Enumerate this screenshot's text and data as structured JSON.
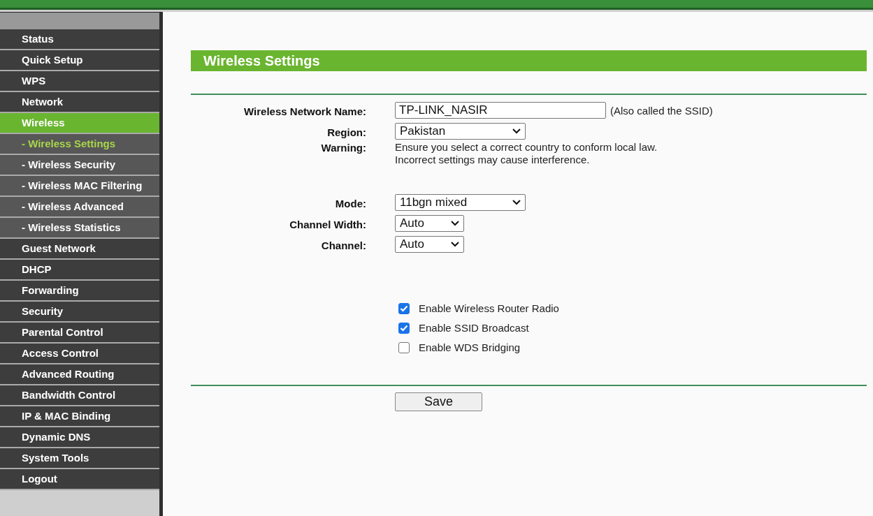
{
  "sidebar": {
    "items": [
      {
        "label": "Status",
        "kind": "main",
        "selected": false
      },
      {
        "label": "Quick Setup",
        "kind": "main",
        "selected": false
      },
      {
        "label": "WPS",
        "kind": "main",
        "selected": false
      },
      {
        "label": "Network",
        "kind": "main",
        "selected": false
      },
      {
        "label": "Wireless",
        "kind": "main",
        "selected": true
      },
      {
        "label": "- Wireless Settings",
        "kind": "sub",
        "selected": true
      },
      {
        "label": "- Wireless Security",
        "kind": "sub",
        "selected": false
      },
      {
        "label": "- Wireless MAC Filtering",
        "kind": "sub",
        "selected": false
      },
      {
        "label": "- Wireless Advanced",
        "kind": "sub",
        "selected": false
      },
      {
        "label": "- Wireless Statistics",
        "kind": "sub",
        "selected": false
      },
      {
        "label": "Guest Network",
        "kind": "main",
        "selected": false
      },
      {
        "label": "DHCP",
        "kind": "main",
        "selected": false
      },
      {
        "label": "Forwarding",
        "kind": "main",
        "selected": false
      },
      {
        "label": "Security",
        "kind": "main",
        "selected": false
      },
      {
        "label": "Parental Control",
        "kind": "main",
        "selected": false
      },
      {
        "label": "Access Control",
        "kind": "main",
        "selected": false
      },
      {
        "label": "Advanced Routing",
        "kind": "main",
        "selected": false
      },
      {
        "label": "Bandwidth Control",
        "kind": "main",
        "selected": false
      },
      {
        "label": "IP & MAC Binding",
        "kind": "main",
        "selected": false
      },
      {
        "label": "Dynamic DNS",
        "kind": "main",
        "selected": false
      },
      {
        "label": "System Tools",
        "kind": "main",
        "selected": false
      },
      {
        "label": "Logout",
        "kind": "main",
        "selected": false
      }
    ]
  },
  "page": {
    "title": "Wireless Settings",
    "fields": [
      {
        "kind": "text",
        "label": "Wireless Network Name:",
        "value": "TP-LINK_NASIR",
        "note": "(Also called the SSID)"
      },
      {
        "kind": "wide-select",
        "label": "Region:",
        "value": "Pakistan"
      },
      {
        "kind": "info",
        "label": "Warning:",
        "lines": [
          "Ensure you select a correct country to conform local law.",
          "Incorrect settings may cause interference."
        ]
      },
      {
        "kind": "wide-select",
        "label": "Mode:",
        "value": "11bgn mixed"
      },
      {
        "kind": "narrow-select",
        "label": "Channel Width:",
        "value": "Auto"
      },
      {
        "kind": "narrow-select",
        "label": "Channel:",
        "value": "Auto"
      }
    ],
    "options": [
      {
        "label": "Enable Wireless Router Radio",
        "checked": true
      },
      {
        "label": "Enable SSID Broadcast",
        "checked": true
      },
      {
        "label": "Enable WDS Bridging",
        "checked": false
      }
    ],
    "save_button": "Save"
  }
}
